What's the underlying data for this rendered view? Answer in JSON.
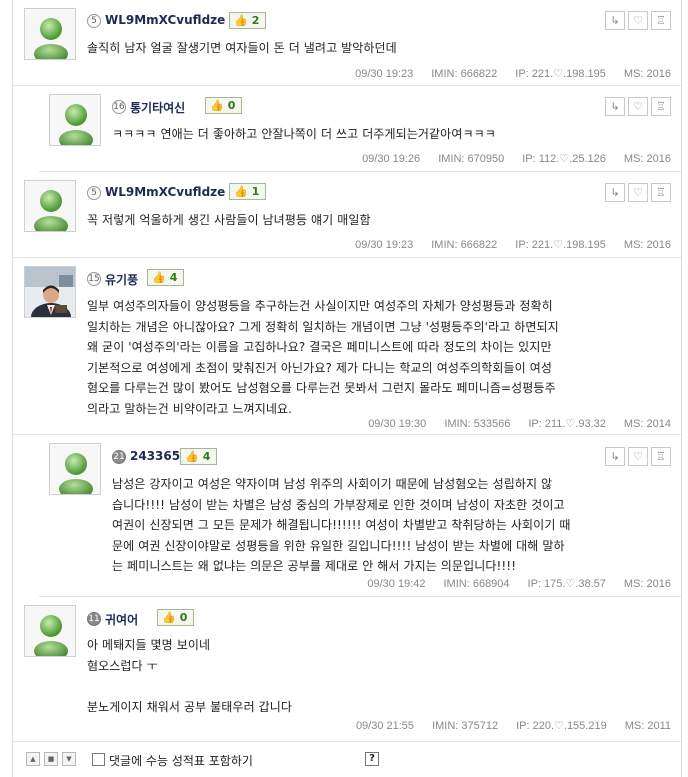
{
  "comments": [
    {
      "level": "5",
      "nickname": "WL9MmXCvufldze",
      "likes": "2",
      "lines": [
        "솔직히 남자 얼굴 잘생기면 여자들이 돈 더 낼려고 발악하던데"
      ],
      "date": "09/30 19:23",
      "imin": "IMIN: 666822",
      "ip": "IP: 221.♡.198.195",
      "ms": "MS: 2016"
    },
    {
      "level": "16",
      "nickname": "통기타여신",
      "likes": "0",
      "lines": [
        "ㅋㅋㅋㅋ 연애는 더 좋아하고 안잘나쪽이 더 쓰고 더주게되는거같아여ㅋㅋㅋ"
      ],
      "date": "09/30 19:26",
      "imin": "IMIN: 670950",
      "ip": "IP: 112.♡.25.126",
      "ms": "MS: 2016"
    },
    {
      "level": "5",
      "nickname": "WL9MmXCvufldze",
      "likes": "1",
      "lines": [
        "꼭 저렇게 억울하게 생긴 사람들이 남녀평등 얘기 매일함"
      ],
      "date": "09/30 19:23",
      "imin": "IMIN: 666822",
      "ip": "IP: 221.♡.198.195",
      "ms": "MS: 2016"
    },
    {
      "level": "15",
      "nickname": "유기풍",
      "likes": "4",
      "lines": [
        "일부 여성주의자들이 양성평등을 추구하는건 사실이지만 여성주의 자체가 양성평등과 정확히",
        "일치하는 개념은 아니잖아요? 그게 정확히 일치하는 개념이면 그냥 '성평등주의'라고 하면되지",
        "왜 굳이 '여성주의'라는 이름을 고집하나요? 결국은 페미니스트에 따라 정도의 차이는 있지만",
        "기본적으로 여성에게 초점이 맞춰진거 아닌가요? 제가 다니는 학교의 여성주의학회들이 여성",
        "혐오를 다루는건 많이 봤어도 남성혐오를 다루는건 못봐서 그런지 몰라도 페미니즘=성평등주",
        "의라고 말하는건 비약이라고 느껴지네요."
      ],
      "date": "09/30 19:30",
      "imin": "IMIN: 533566",
      "ip": "IP: 211.♡.93.32",
      "ms": "MS: 2014"
    },
    {
      "level": "21",
      "nickname": "243365",
      "likes": "4",
      "lines": [
        "남성은 강자이고 여성은 약자이며 남성 위주의 사회이기 때문에 남성혐오는 성립하지 않",
        "습니다!!!! 남성이 받는 차별은 남성 중심의 가부장제로 인한 것이며 남성이 자초한 것이고",
        "여권이 신장되면 그 모든 문제가 해결됩니다!!!!!! 여성이 차별받고 착취당하는 사회이기 때",
        "문에 여권 신장이야말로 성평등을 위한 유일한 길입니다!!!! 남성이 받는 차별에 대해 말하",
        "는 페미니스트는 왜 없냐는 의문은 공부를 제대로 안 해서 가지는 의문입니다!!!!"
      ],
      "date": "09/30 19:42",
      "imin": "IMIN: 668904",
      "ip": "IP: 175.♡.38.57",
      "ms": "MS: 2016"
    },
    {
      "level": "11",
      "nickname": "귀여어",
      "likes": "0",
      "lines": [
        "아 메퇘지들 몇명 보이네",
        "혐오스럽다 ㅜ",
        "",
        "분노게이지 채워서 공부 불태우러 갑니다"
      ],
      "date": "09/30 21:55",
      "imin": "IMIN: 375712",
      "ip": "IP: 220.♡.155.219",
      "ms": "MS: 2011"
    }
  ],
  "actions": {
    "reply_icon": "reply-arrow-icon",
    "heart_icon": "heart-icon",
    "report_icon": "siren-icon"
  },
  "footer": {
    "up_icon": "▲",
    "stop_icon": "■",
    "down_icon": "▼",
    "checkbox_label": "댓글에 수능 성적표 포함하기",
    "help_label": "?"
  },
  "colors": {
    "nickname": "#1e2a56",
    "like_text": "#2f7a1c",
    "meta": "#888888"
  }
}
